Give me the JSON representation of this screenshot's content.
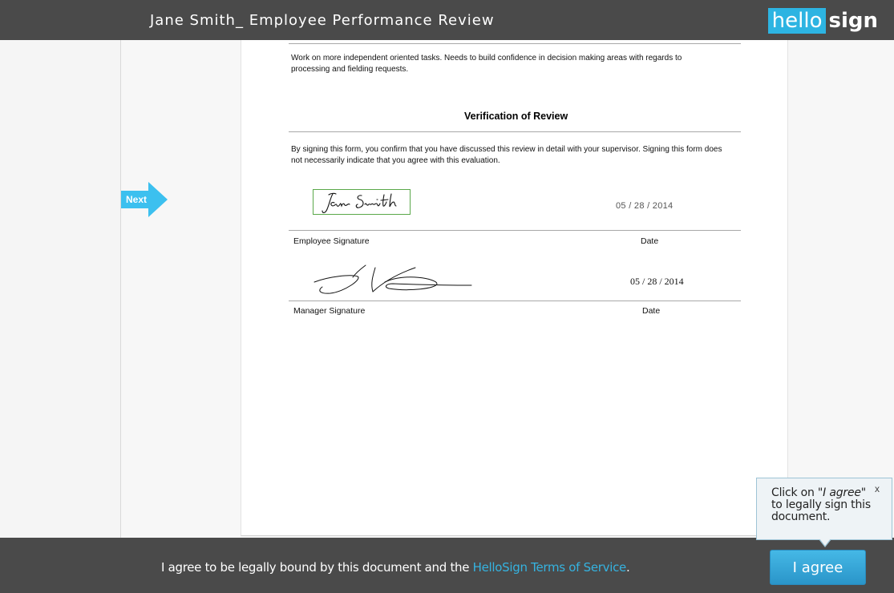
{
  "header": {
    "doc_title": "Jane Smith_ Employee Performance Review",
    "logo_hello": "hello",
    "logo_sign": "sign"
  },
  "nav": {
    "next_label": "Next"
  },
  "document": {
    "comments_text_line1": "Work on more independent oriented tasks. Needs to build confidence in decision making areas with regards to",
    "comments_text_line2": "processing and fielding requests.",
    "verification_heading": "Verification of Review",
    "verification_text_line1": "By signing this form, you confirm that you have discussed this review in detail with your supervisor.  Signing this form does",
    "verification_text_line2": "not necessarily indicate that you agree with this evaluation.",
    "employee_signature_value": "Jane Smith",
    "employee_date_value": "05 / 28 / 2014",
    "employee_signature_label": "Employee Signature",
    "date_label_1": "Date",
    "manager_date_value": "05 / 28 / 2014",
    "manager_signature_label": "Manager Signature",
    "date_label_2": "Date"
  },
  "tooltip": {
    "pre": "Click on \"",
    "emph": "I agree",
    "post": "\" to legally sign this document.",
    "close": "x"
  },
  "footer": {
    "agree_text": "I agree to be legally bound by this document and the ",
    "terms_link": "HelloSign Terms of Service",
    "agree_period": ".",
    "agree_button": "I agree"
  },
  "colors": {
    "accent": "#2db4e2",
    "bar": "#4a4a4a",
    "signature_box_border": "#5aa84a"
  }
}
